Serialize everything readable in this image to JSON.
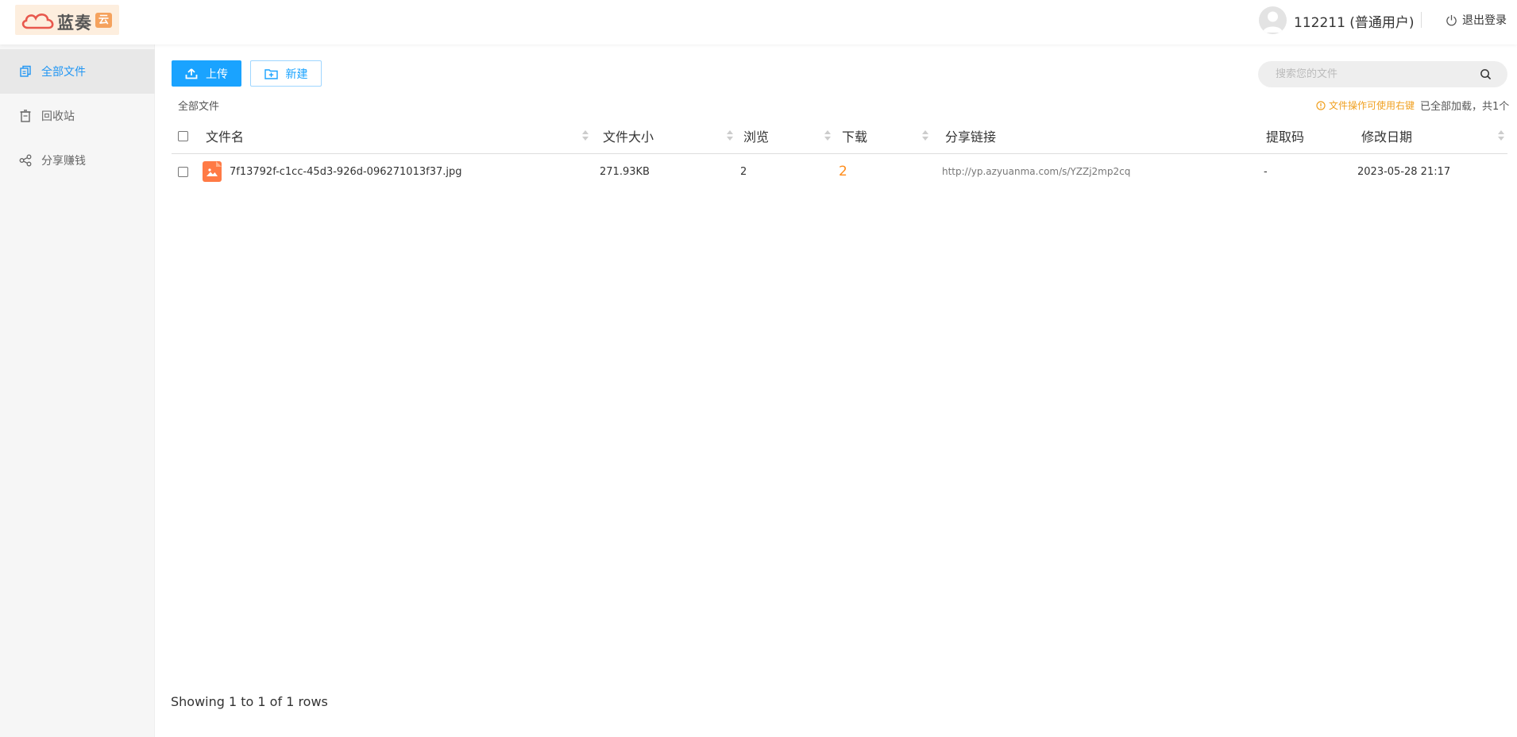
{
  "header": {
    "logo_text": "蓝奏",
    "logo_badge": "云",
    "username": "112211 (普通用户)",
    "logout_label": "退出登录"
  },
  "sidebar": {
    "items": [
      {
        "label": "全部文件",
        "icon": "files-icon",
        "active": true
      },
      {
        "label": "回收站",
        "icon": "trash-icon",
        "active": false
      },
      {
        "label": "分享赚钱",
        "icon": "share-icon",
        "active": false
      }
    ]
  },
  "toolbar": {
    "upload_label": "上传",
    "new_label": "新建"
  },
  "search": {
    "placeholder": "搜索您的文件",
    "value": ""
  },
  "breadcrumb": "全部文件",
  "tip": "文件操作可使用右键",
  "loaded_status": "已全部加载，共1个",
  "table": {
    "columns": [
      "文件名",
      "文件大小",
      "浏览",
      "下载",
      "分享链接",
      "提取码",
      "修改日期"
    ],
    "rows": [
      {
        "name": "7f13792f-c1cc-45d3-926d-096271013f37.jpg",
        "size": "271.93KB",
        "views": "2",
        "downloads": "2",
        "share_link": "http://yp.azyuanma.com/s/YZZj2mp2cq",
        "code": "-",
        "modified": "2023-05-28 21:17"
      }
    ]
  },
  "pagination_info": "Showing 1 to 1 of 1 rows",
  "colors": {
    "primary": "#1aa3ff",
    "accent_orange": "#ff8c1a",
    "file_icon": "#ff7a45",
    "sidebar_bg": "#f6f6f6"
  }
}
